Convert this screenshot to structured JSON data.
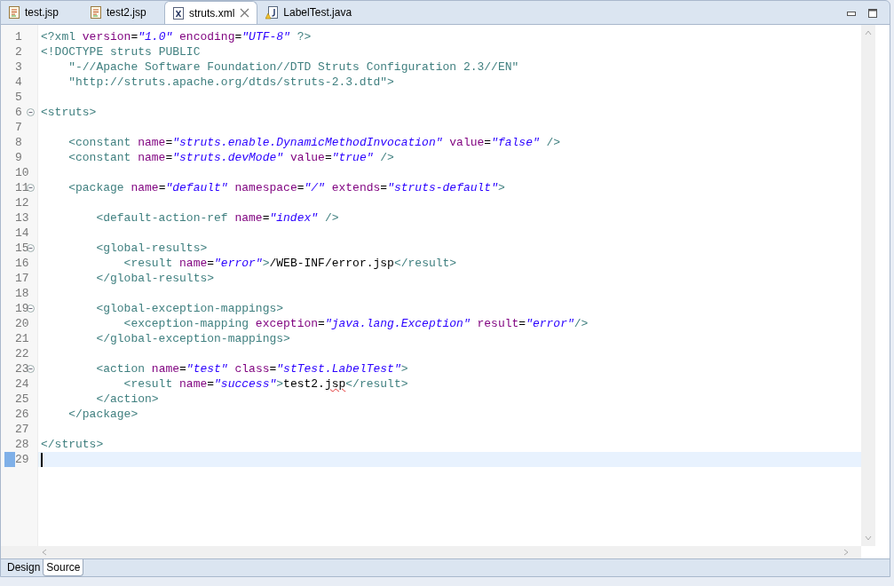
{
  "tabs": [
    {
      "label": "test.jsp",
      "kind": "jsp",
      "selected": false,
      "closable": false
    },
    {
      "label": "test2.jsp",
      "kind": "jsp",
      "selected": false,
      "closable": false
    },
    {
      "label": "struts.xml",
      "kind": "xml",
      "selected": true,
      "closable": true
    },
    {
      "label": "LabelTest.java",
      "kind": "java",
      "selected": false,
      "closable": false
    }
  ],
  "lines": [
    {
      "number": "1",
      "foldable": false,
      "current": false,
      "tokens": [
        {
          "kind": "tag",
          "text": "<?xml "
        },
        {
          "kind": "attr",
          "text": "version"
        },
        {
          "kind": "text",
          "text": "="
        },
        {
          "kind": "value",
          "text": "\"1.0\""
        },
        {
          "kind": "attr",
          "text": " encoding"
        },
        {
          "kind": "text",
          "text": "="
        },
        {
          "kind": "value",
          "text": "\"UTF-8\""
        },
        {
          "kind": "tag",
          "text": " ?>"
        }
      ]
    },
    {
      "number": "2",
      "foldable": false,
      "current": false,
      "tokens": [
        {
          "kind": "tag",
          "text": "<!DOCTYPE struts "
        },
        {
          "kind": "keyword",
          "text": "PUBLIC"
        }
      ]
    },
    {
      "number": "3",
      "foldable": false,
      "current": false,
      "tokens": [
        {
          "kind": "dtd",
          "text": "    \"-//Apache Software Foundation//DTD Struts Configuration 2.3//EN\""
        }
      ]
    },
    {
      "number": "4",
      "foldable": false,
      "current": false,
      "tokens": [
        {
          "kind": "dtd",
          "text": "    \"http://struts.apache.org/dtds/struts-2.3.dtd\">"
        }
      ]
    },
    {
      "number": "5",
      "foldable": false,
      "current": false
    },
    {
      "number": "6",
      "foldable": true,
      "current": false,
      "tokens": [
        {
          "kind": "tag",
          "text": "<struts>"
        }
      ]
    },
    {
      "number": "7",
      "foldable": false,
      "current": false
    },
    {
      "number": "8",
      "foldable": false,
      "current": false,
      "tokens": [
        {
          "kind": "tag",
          "text": "    <constant "
        },
        {
          "kind": "attr",
          "text": "name"
        },
        {
          "kind": "text",
          "text": "="
        },
        {
          "kind": "value",
          "text": "\"struts.enable.DynamicMethodInvocation\""
        },
        {
          "kind": "attr",
          "text": " value"
        },
        {
          "kind": "text",
          "text": "="
        },
        {
          "kind": "value",
          "text": "\"false\""
        },
        {
          "kind": "tag",
          "text": " />"
        }
      ]
    },
    {
      "number": "9",
      "foldable": false,
      "current": false,
      "tokens": [
        {
          "kind": "tag",
          "text": "    <constant "
        },
        {
          "kind": "attr",
          "text": "name"
        },
        {
          "kind": "text",
          "text": "="
        },
        {
          "kind": "value",
          "text": "\"struts.devMode\""
        },
        {
          "kind": "attr",
          "text": " value"
        },
        {
          "kind": "text",
          "text": "="
        },
        {
          "kind": "value",
          "text": "\"true\""
        },
        {
          "kind": "tag",
          "text": " />"
        }
      ]
    },
    {
      "number": "10",
      "foldable": false,
      "current": false
    },
    {
      "number": "11",
      "foldable": true,
      "current": false,
      "tokens": [
        {
          "kind": "tag",
          "text": "    <package "
        },
        {
          "kind": "attr",
          "text": "name"
        },
        {
          "kind": "text",
          "text": "="
        },
        {
          "kind": "value",
          "text": "\"default\""
        },
        {
          "kind": "attr",
          "text": " namespace"
        },
        {
          "kind": "text",
          "text": "="
        },
        {
          "kind": "value",
          "text": "\"/\""
        },
        {
          "kind": "attr",
          "text": " extends"
        },
        {
          "kind": "text",
          "text": "="
        },
        {
          "kind": "value",
          "text": "\"struts-default\""
        },
        {
          "kind": "tag",
          "text": ">"
        }
      ]
    },
    {
      "number": "12",
      "foldable": false,
      "current": false
    },
    {
      "number": "13",
      "foldable": false,
      "current": false,
      "tokens": [
        {
          "kind": "tag",
          "text": "        <default-action-ref "
        },
        {
          "kind": "attr",
          "text": "name"
        },
        {
          "kind": "text",
          "text": "="
        },
        {
          "kind": "value",
          "text": "\"index\""
        },
        {
          "kind": "tag",
          "text": " />"
        }
      ]
    },
    {
      "number": "14",
      "foldable": false,
      "current": false
    },
    {
      "number": "15",
      "foldable": true,
      "current": false,
      "tokens": [
        {
          "kind": "tag",
          "text": "        <global-results>"
        }
      ]
    },
    {
      "number": "16",
      "foldable": false,
      "current": false,
      "tokens": [
        {
          "kind": "tag",
          "text": "            <result "
        },
        {
          "kind": "attr",
          "text": "name"
        },
        {
          "kind": "text",
          "text": "="
        },
        {
          "kind": "value",
          "text": "\"error\""
        },
        {
          "kind": "tag",
          "text": ">"
        },
        {
          "kind": "text",
          "text": "/WEB-INF/error.jsp"
        },
        {
          "kind": "tag",
          "text": "</result>"
        }
      ]
    },
    {
      "number": "17",
      "foldable": false,
      "current": false,
      "tokens": [
        {
          "kind": "tag",
          "text": "        </global-results>"
        }
      ]
    },
    {
      "number": "18",
      "foldable": false,
      "current": false
    },
    {
      "number": "19",
      "foldable": true,
      "current": false,
      "tokens": [
        {
          "kind": "tag",
          "text": "        <global-exception-mappings>"
        }
      ]
    },
    {
      "number": "20",
      "foldable": false,
      "current": false,
      "tokens": [
        {
          "kind": "tag",
          "text": "            <exception-mapping "
        },
        {
          "kind": "attr",
          "text": "exception"
        },
        {
          "kind": "text",
          "text": "="
        },
        {
          "kind": "value",
          "text": "\"java.lang.Exception\""
        },
        {
          "kind": "attr",
          "text": " result"
        },
        {
          "kind": "text",
          "text": "="
        },
        {
          "kind": "value",
          "text": "\"error\""
        },
        {
          "kind": "tag",
          "text": "/>"
        }
      ]
    },
    {
      "number": "21",
      "foldable": false,
      "current": false,
      "tokens": [
        {
          "kind": "tag",
          "text": "        </global-exception-mappings>"
        }
      ]
    },
    {
      "number": "22",
      "foldable": false,
      "current": false
    },
    {
      "number": "23",
      "foldable": true,
      "current": false,
      "tokens": [
        {
          "kind": "tag",
          "text": "        <action "
        },
        {
          "kind": "attr",
          "text": "name"
        },
        {
          "kind": "text",
          "text": "="
        },
        {
          "kind": "value",
          "text": "\"test\""
        },
        {
          "kind": "attr",
          "text": " class"
        },
        {
          "kind": "text",
          "text": "="
        },
        {
          "kind": "value",
          "text": "\"stTest.LabelTest\""
        },
        {
          "kind": "tag",
          "text": ">"
        }
      ]
    },
    {
      "number": "24",
      "foldable": false,
      "current": false,
      "tokens": [
        {
          "kind": "tag",
          "text": "            <result "
        },
        {
          "kind": "attr",
          "text": "name"
        },
        {
          "kind": "text",
          "text": "="
        },
        {
          "kind": "value",
          "text": "\"success\""
        },
        {
          "kind": "tag",
          "text": ">"
        },
        {
          "kind": "text",
          "text": "test2."
        },
        {
          "kind": "misspelled",
          "text": "jsp"
        },
        {
          "kind": "tag",
          "text": "</result>"
        }
      ]
    },
    {
      "number": "25",
      "foldable": false,
      "current": false,
      "tokens": [
        {
          "kind": "tag",
          "text": "        </action>"
        }
      ]
    },
    {
      "number": "26",
      "foldable": false,
      "current": false,
      "tokens": [
        {
          "kind": "tag",
          "text": "    </package>"
        }
      ]
    },
    {
      "number": "27",
      "foldable": false,
      "current": false
    },
    {
      "number": "28",
      "foldable": false,
      "current": false,
      "tokens": [
        {
          "kind": "tag",
          "text": "</struts>"
        }
      ]
    },
    {
      "number": "29",
      "foldable": false,
      "current": true
    }
  ],
  "bottom_tabs": [
    {
      "label": "Design",
      "selected": false
    },
    {
      "label": "Source",
      "selected": true
    }
  ]
}
